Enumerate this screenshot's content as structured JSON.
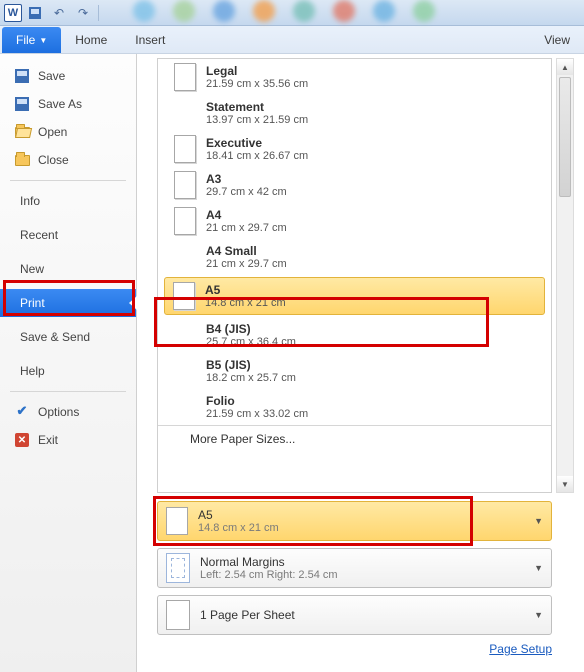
{
  "qat": {
    "word_letter": "W"
  },
  "ribbon": {
    "file": "File",
    "tabs": [
      "Home",
      "Insert",
      "",
      "",
      "",
      "",
      "",
      "View"
    ]
  },
  "sidebar": {
    "save": "Save",
    "save_as": "Save As",
    "open": "Open",
    "close": "Close",
    "info": "Info",
    "recent": "Recent",
    "new": "New",
    "print": "Print",
    "save_send": "Save & Send",
    "help": "Help",
    "options": "Options",
    "exit": "Exit"
  },
  "sizes": {
    "legal": {
      "name": "Legal",
      "dim": "21.59 cm x 35.56 cm"
    },
    "statement": {
      "name": "Statement",
      "dim": "13.97 cm x 21.59 cm"
    },
    "executive": {
      "name": "Executive",
      "dim": "18.41 cm x 26.67 cm"
    },
    "a3": {
      "name": "A3",
      "dim": "29.7 cm x 42 cm"
    },
    "a4": {
      "name": "A4",
      "dim": "21 cm x 29.7 cm"
    },
    "a4small": {
      "name": "A4 Small",
      "dim": "21 cm x 29.7 cm"
    },
    "a5": {
      "name": "A5",
      "dim": "14.8 cm x 21 cm"
    },
    "b4": {
      "name": "B4 (JIS)",
      "dim": "25.7 cm x 36.4 cm"
    },
    "b5": {
      "name": "B5 (JIS)",
      "dim": "18.2 cm x 25.7 cm"
    },
    "folio": {
      "name": "Folio",
      "dim": "21.59 cm x 33.02 cm"
    },
    "more": "More Paper Sizes..."
  },
  "summary": {
    "size": {
      "name": "A5",
      "dim": "14.8 cm x 21 cm"
    },
    "margins": {
      "name": "Normal Margins",
      "detail": "Left: 2.54 cm   Right: 2.54 cm"
    },
    "sheet": {
      "name": "1 Page Per Sheet"
    }
  },
  "links": {
    "page_setup": "Page Setup"
  }
}
